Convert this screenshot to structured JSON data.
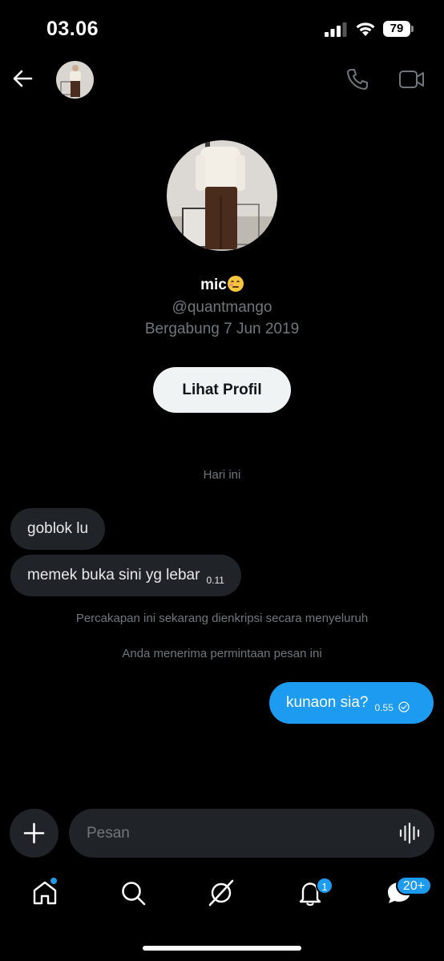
{
  "status_bar": {
    "time": "03.06",
    "battery": "79"
  },
  "header": {
    "avatar_alt": ""
  },
  "profile": {
    "name": "mic",
    "handle": "@quantmango",
    "joined": "Bergabung 7 Jun 2019",
    "view_profile_label": "Lihat Profil"
  },
  "conversation": {
    "date_divider": "Hari ini",
    "incoming": [
      {
        "text": "goblok lu",
        "time": ""
      },
      {
        "text": "memek buka sini yg lebar",
        "time": "0.11"
      }
    ],
    "notes": [
      "Percakapan ini sekarang dienkripsi secara menyeluruh",
      "Anda menerima permintaan pesan ini"
    ],
    "outgoing": [
      {
        "text": "kunaon sia?",
        "time": "0.55"
      }
    ]
  },
  "composer": {
    "placeholder": "Pesan"
  },
  "bottom_nav": {
    "items": [
      "home-icon",
      "search-icon",
      "grok-icon",
      "bell-icon",
      "messages-icon"
    ],
    "notifications_badge": "1",
    "messages_badge": "20+"
  },
  "colors": {
    "accent": "#1d9bf0",
    "bubble_in": "#202327",
    "background": "#000000",
    "muted": "#71767b"
  }
}
